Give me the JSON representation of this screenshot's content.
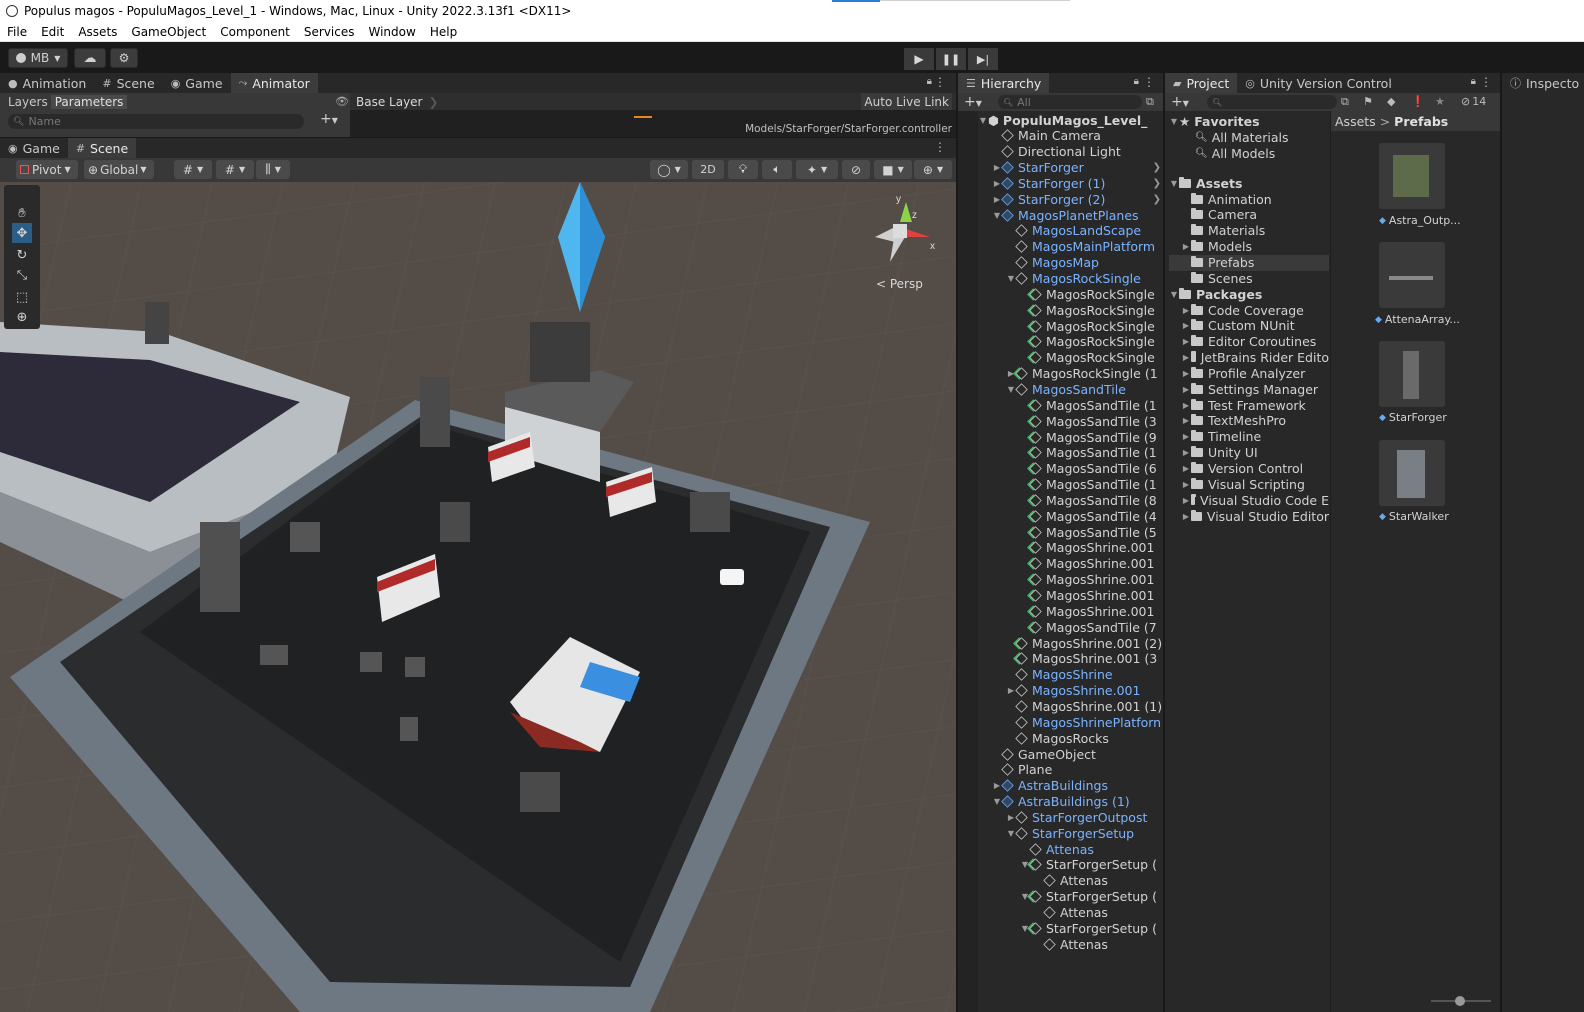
{
  "window": {
    "title": "Populus magos - PopuluMagos_Level_1 - Windows, Mac, Linux - Unity 2022.3.13f1 <DX11>"
  },
  "menu": [
    "File",
    "Edit",
    "Assets",
    "GameObject",
    "Component",
    "Services",
    "Window",
    "Help"
  ],
  "toolbar": {
    "account": "MB"
  },
  "animator": {
    "tabs": [
      {
        "label": "Animation",
        "icon": "animation-icon"
      },
      {
        "label": "Scene",
        "icon": "scene-grid-icon"
      },
      {
        "label": "Game",
        "icon": "gamepad-icon"
      },
      {
        "label": "Animator",
        "icon": "animator-icon"
      }
    ],
    "layers_tab": "Layers",
    "parameters_tab": "Parameters",
    "base_layer": "Base Layer",
    "auto_live_link": "Auto Live Link",
    "search_placeholder": "Name",
    "controller_path": "Models/StarForger/StarForger.controller"
  },
  "scene": {
    "tabs": [
      {
        "label": "Game"
      },
      {
        "label": "Scene"
      }
    ],
    "pivot": "Pivot",
    "global": "Global",
    "mode_2d": "2D",
    "persp_label": "< Persp"
  },
  "hierarchy": {
    "tab": "Hierarchy",
    "search_placeholder": "All",
    "items": [
      {
        "label": "PopuluMagos_Level_",
        "indent": 0,
        "arrow": "down",
        "icon": "unity",
        "color": "white",
        "bold": true
      },
      {
        "label": "Main Camera",
        "indent": 1,
        "arrow": "",
        "icon": "cube",
        "color": "white"
      },
      {
        "label": "Directional Light",
        "indent": 1,
        "arrow": "",
        "icon": "cube",
        "color": "white"
      },
      {
        "label": "StarForger",
        "indent": 1,
        "arrow": "right",
        "icon": "prefab",
        "color": "blue",
        "more": true
      },
      {
        "label": "StarForger (1)",
        "indent": 1,
        "arrow": "right",
        "icon": "prefab",
        "color": "blue",
        "more": true
      },
      {
        "label": "StarForger (2)",
        "indent": 1,
        "arrow": "right",
        "icon": "prefab",
        "color": "blue",
        "more": true
      },
      {
        "label": "MagosPlanetPlanes",
        "indent": 1,
        "arrow": "down",
        "icon": "prefab",
        "color": "blue"
      },
      {
        "label": "MagosLandScape",
        "indent": 2,
        "arrow": "",
        "icon": "cube",
        "color": "blue"
      },
      {
        "label": "MagosMainPlatform",
        "indent": 2,
        "arrow": "",
        "icon": "cube",
        "color": "blue"
      },
      {
        "label": "MagosMap",
        "indent": 2,
        "arrow": "",
        "icon": "cube",
        "color": "blue"
      },
      {
        "label": "MagosRockSingle",
        "indent": 2,
        "arrow": "down",
        "icon": "cube",
        "color": "blue"
      },
      {
        "label": "MagosRockSingle",
        "indent": 3,
        "arrow": "",
        "icon": "green",
        "color": "white"
      },
      {
        "label": "MagosRockSingle",
        "indent": 3,
        "arrow": "",
        "icon": "green",
        "color": "white"
      },
      {
        "label": "MagosRockSingle",
        "indent": 3,
        "arrow": "",
        "icon": "green",
        "color": "white"
      },
      {
        "label": "MagosRockSingle",
        "indent": 3,
        "arrow": "",
        "icon": "green",
        "color": "white"
      },
      {
        "label": "MagosRockSingle",
        "indent": 3,
        "arrow": "",
        "icon": "green",
        "color": "white"
      },
      {
        "label": "MagosRockSingle (1",
        "indent": 2,
        "arrow": "right",
        "icon": "green",
        "color": "white"
      },
      {
        "label": "MagosSandTile",
        "indent": 2,
        "arrow": "down",
        "icon": "cube",
        "color": "blue"
      },
      {
        "label": "MagosSandTile (1",
        "indent": 3,
        "arrow": "",
        "icon": "green",
        "color": "white"
      },
      {
        "label": "MagosSandTile (3",
        "indent": 3,
        "arrow": "",
        "icon": "green",
        "color": "white"
      },
      {
        "label": "MagosSandTile (9",
        "indent": 3,
        "arrow": "",
        "icon": "green",
        "color": "white"
      },
      {
        "label": "MagosSandTile (1",
        "indent": 3,
        "arrow": "",
        "icon": "green",
        "color": "white"
      },
      {
        "label": "MagosSandTile (6",
        "indent": 3,
        "arrow": "",
        "icon": "green",
        "color": "white"
      },
      {
        "label": "MagosSandTile (1",
        "indent": 3,
        "arrow": "",
        "icon": "green",
        "color": "white"
      },
      {
        "label": "MagosSandTile (8",
        "indent": 3,
        "arrow": "",
        "icon": "green",
        "color": "white"
      },
      {
        "label": "MagosSandTile (4",
        "indent": 3,
        "arrow": "",
        "icon": "green",
        "color": "white"
      },
      {
        "label": "MagosSandTile (5",
        "indent": 3,
        "arrow": "",
        "icon": "green",
        "color": "white"
      },
      {
        "label": "MagosShrine.001",
        "indent": 3,
        "arrow": "",
        "icon": "green",
        "color": "white"
      },
      {
        "label": "MagosShrine.001",
        "indent": 3,
        "arrow": "",
        "icon": "green",
        "color": "white"
      },
      {
        "label": "MagosShrine.001",
        "indent": 3,
        "arrow": "",
        "icon": "green",
        "color": "white"
      },
      {
        "label": "MagosShrine.001",
        "indent": 3,
        "arrow": "",
        "icon": "green",
        "color": "white"
      },
      {
        "label": "MagosShrine.001",
        "indent": 3,
        "arrow": "",
        "icon": "green",
        "color": "white"
      },
      {
        "label": "MagosSandTile (7",
        "indent": 3,
        "arrow": "",
        "icon": "green",
        "color": "white"
      },
      {
        "label": "MagosShrine.001 (2)",
        "indent": 2,
        "arrow": "",
        "icon": "green",
        "color": "white"
      },
      {
        "label": "MagosShrine.001 (3",
        "indent": 2,
        "arrow": "",
        "icon": "green",
        "color": "white"
      },
      {
        "label": "MagosShrine",
        "indent": 2,
        "arrow": "",
        "icon": "cube",
        "color": "blue"
      },
      {
        "label": "MagosShrine.001",
        "indent": 2,
        "arrow": "right",
        "icon": "cube",
        "color": "blue"
      },
      {
        "label": "MagosShrine.001 (1)",
        "indent": 2,
        "arrow": "",
        "icon": "cube",
        "color": "white"
      },
      {
        "label": "MagosShrinePlatforn",
        "indent": 2,
        "arrow": "",
        "icon": "cube",
        "color": "blue"
      },
      {
        "label": "MagosRocks",
        "indent": 2,
        "arrow": "",
        "icon": "cube",
        "color": "white"
      },
      {
        "label": "GameObject",
        "indent": 1,
        "arrow": "",
        "icon": "cube",
        "color": "white"
      },
      {
        "label": "Plane",
        "indent": 1,
        "arrow": "",
        "icon": "cube",
        "color": "white"
      },
      {
        "label": "AstraBuildings",
        "indent": 1,
        "arrow": "right",
        "icon": "prefab",
        "color": "blue"
      },
      {
        "label": "AstraBuildings (1)",
        "indent": 1,
        "arrow": "down",
        "icon": "prefab",
        "color": "blue"
      },
      {
        "label": "StarForgerOutpost",
        "indent": 2,
        "arrow": "right",
        "icon": "cube",
        "color": "blue"
      },
      {
        "label": "StarForgerSetup",
        "indent": 2,
        "arrow": "down",
        "icon": "cube",
        "color": "blue"
      },
      {
        "label": "Attenas",
        "indent": 3,
        "arrow": "",
        "icon": "cube",
        "color": "blue"
      },
      {
        "label": "StarForgerSetup (",
        "indent": 3,
        "arrow": "down",
        "icon": "green",
        "color": "white"
      },
      {
        "label": "Attenas",
        "indent": 4,
        "arrow": "",
        "icon": "cube",
        "color": "white"
      },
      {
        "label": "StarForgerSetup (",
        "indent": 3,
        "arrow": "down",
        "icon": "green",
        "color": "white"
      },
      {
        "label": "Attenas",
        "indent": 4,
        "arrow": "",
        "icon": "cube",
        "color": "white"
      },
      {
        "label": "StarForgerSetup (",
        "indent": 3,
        "arrow": "down",
        "icon": "green",
        "color": "white"
      },
      {
        "label": "Attenas",
        "indent": 4,
        "arrow": "",
        "icon": "cube",
        "color": "white"
      }
    ]
  },
  "project": {
    "tabs": [
      {
        "label": "Project"
      },
      {
        "label": "Unity Version Control"
      }
    ],
    "inspector_tab": "Inspecto",
    "hidden_count": "14",
    "breadcrumb": [
      "Assets",
      "Prefabs"
    ],
    "favorites": {
      "label": "Favorites",
      "items": [
        "All Materials",
        "All Models"
      ]
    },
    "assets": {
      "label": "Assets",
      "items": [
        {
          "label": "Animation",
          "arrow": false
        },
        {
          "label": "Camera",
          "arrow": false
        },
        {
          "label": "Materials",
          "arrow": false
        },
        {
          "label": "Models",
          "arrow": true
        },
        {
          "label": "Prefabs",
          "arrow": false,
          "selected": true
        },
        {
          "label": "Scenes",
          "arrow": false
        }
      ]
    },
    "packages": {
      "label": "Packages",
      "items": [
        "Code Coverage",
        "Custom NUnit",
        "Editor Coroutines",
        "JetBrains Rider Edito",
        "Profile Analyzer",
        "Settings Manager",
        "Test Framework",
        "TextMeshPro",
        "Timeline",
        "Unity UI",
        "Version Control",
        "Visual Scripting",
        "Visual Studio Code E",
        "Visual Studio Editor"
      ]
    },
    "grid_assets": [
      {
        "label": "Astra_Outp..."
      },
      {
        "label": "AttenaArray..."
      },
      {
        "label": "StarForger"
      },
      {
        "label": "StarWalker"
      }
    ]
  },
  "colors": {
    "accent_blue": "#7cb3ff",
    "selection": "#2c5d87",
    "panel": "#282828",
    "prefab_green": "#3db35a"
  }
}
